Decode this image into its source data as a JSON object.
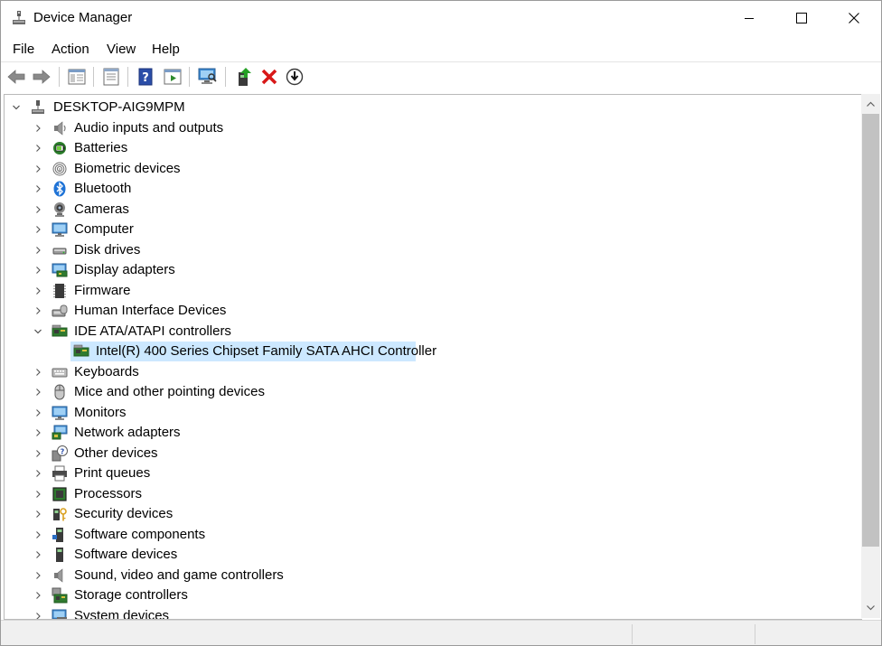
{
  "window": {
    "title": "Device Manager"
  },
  "menu": [
    "File",
    "Action",
    "View",
    "Help"
  ],
  "toolbar": {
    "icons": [
      "back-arrow-icon",
      "forward-arrow-icon",
      "show-hide-console-tree-icon",
      "properties-icon",
      "help-icon",
      "run-icon",
      "scan-hardware-icon",
      "update-driver-icon",
      "uninstall-icon",
      "disable-icon"
    ]
  },
  "tree": {
    "root": "DESKTOP-AIG9MPM",
    "categories": [
      {
        "label": "Audio inputs and outputs",
        "icon": "speaker-icon"
      },
      {
        "label": "Batteries",
        "icon": "battery-icon"
      },
      {
        "label": "Biometric devices",
        "icon": "fingerprint-icon"
      },
      {
        "label": "Bluetooth",
        "icon": "bluetooth-icon"
      },
      {
        "label": "Cameras",
        "icon": "camera-icon"
      },
      {
        "label": "Computer",
        "icon": "computer-icon"
      },
      {
        "label": "Disk drives",
        "icon": "disk-drive-icon"
      },
      {
        "label": "Display adapters",
        "icon": "display-adapter-icon"
      },
      {
        "label": "Firmware",
        "icon": "firmware-icon"
      },
      {
        "label": "Human Interface Devices",
        "icon": "hid-icon"
      },
      {
        "label": "IDE ATA/ATAPI controllers",
        "icon": "ide-controller-icon",
        "expanded": true,
        "children": [
          {
            "label": "Intel(R) 400 Series Chipset Family SATA AHCI Controller",
            "icon": "ide-controller-icon",
            "selected": true
          }
        ]
      },
      {
        "label": "Keyboards",
        "icon": "keyboard-icon"
      },
      {
        "label": "Mice and other pointing devices",
        "icon": "mouse-icon"
      },
      {
        "label": "Monitors",
        "icon": "monitor-icon"
      },
      {
        "label": "Network adapters",
        "icon": "network-adapter-icon"
      },
      {
        "label": "Other devices",
        "icon": "unknown-device-icon"
      },
      {
        "label": "Print queues",
        "icon": "printer-icon"
      },
      {
        "label": "Processors",
        "icon": "processor-icon"
      },
      {
        "label": "Security devices",
        "icon": "security-device-icon"
      },
      {
        "label": "Software components",
        "icon": "software-component-icon"
      },
      {
        "label": "Software devices",
        "icon": "software-device-icon"
      },
      {
        "label": "Sound, video and game controllers",
        "icon": "sound-controller-icon"
      },
      {
        "label": "Storage controllers",
        "icon": "storage-controller-icon"
      },
      {
        "label": "System devices",
        "icon": "system-device-icon"
      }
    ]
  },
  "colors": {
    "selection": "#cce8ff",
    "accent": "#0078d7"
  }
}
